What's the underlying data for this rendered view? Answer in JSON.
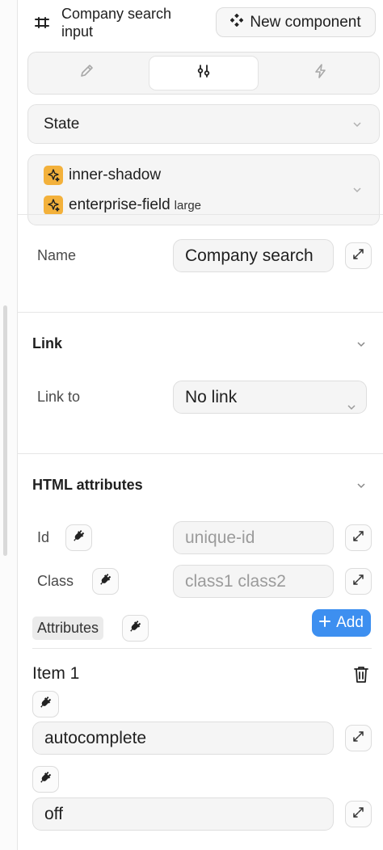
{
  "header": {
    "title": "Company search input",
    "new_component_label": "New component",
    "component_icon": "component-icon",
    "new_component_icon": "diamond-cluster-icon"
  },
  "tabs": [
    {
      "name": "style",
      "icon": "pencil-icon"
    },
    {
      "name": "settings",
      "icon": "sliders-icon",
      "active": true
    },
    {
      "name": "interactions",
      "icon": "lightning-icon"
    }
  ],
  "state": {
    "label": "State"
  },
  "classes": [
    {
      "name": "inner-shadow",
      "modifier": ""
    },
    {
      "name": "enterprise-field",
      "modifier": "large"
    }
  ],
  "name_field": {
    "label": "Name",
    "value": "Company search"
  },
  "link": {
    "title": "Link",
    "link_to_label": "Link to",
    "link_to_value": "No link"
  },
  "html_attributes": {
    "title": "HTML attributes",
    "id_label": "Id",
    "id_placeholder": "unique-id",
    "class_label": "Class",
    "class_placeholder": "class1 class2",
    "attributes_label": "Attributes",
    "add_label": "Add"
  },
  "item": {
    "title": "Item 1",
    "key": "autocomplete",
    "value": "off"
  },
  "colors": {
    "accent": "#3d8ff0",
    "class_badge": "#f3b13b"
  }
}
